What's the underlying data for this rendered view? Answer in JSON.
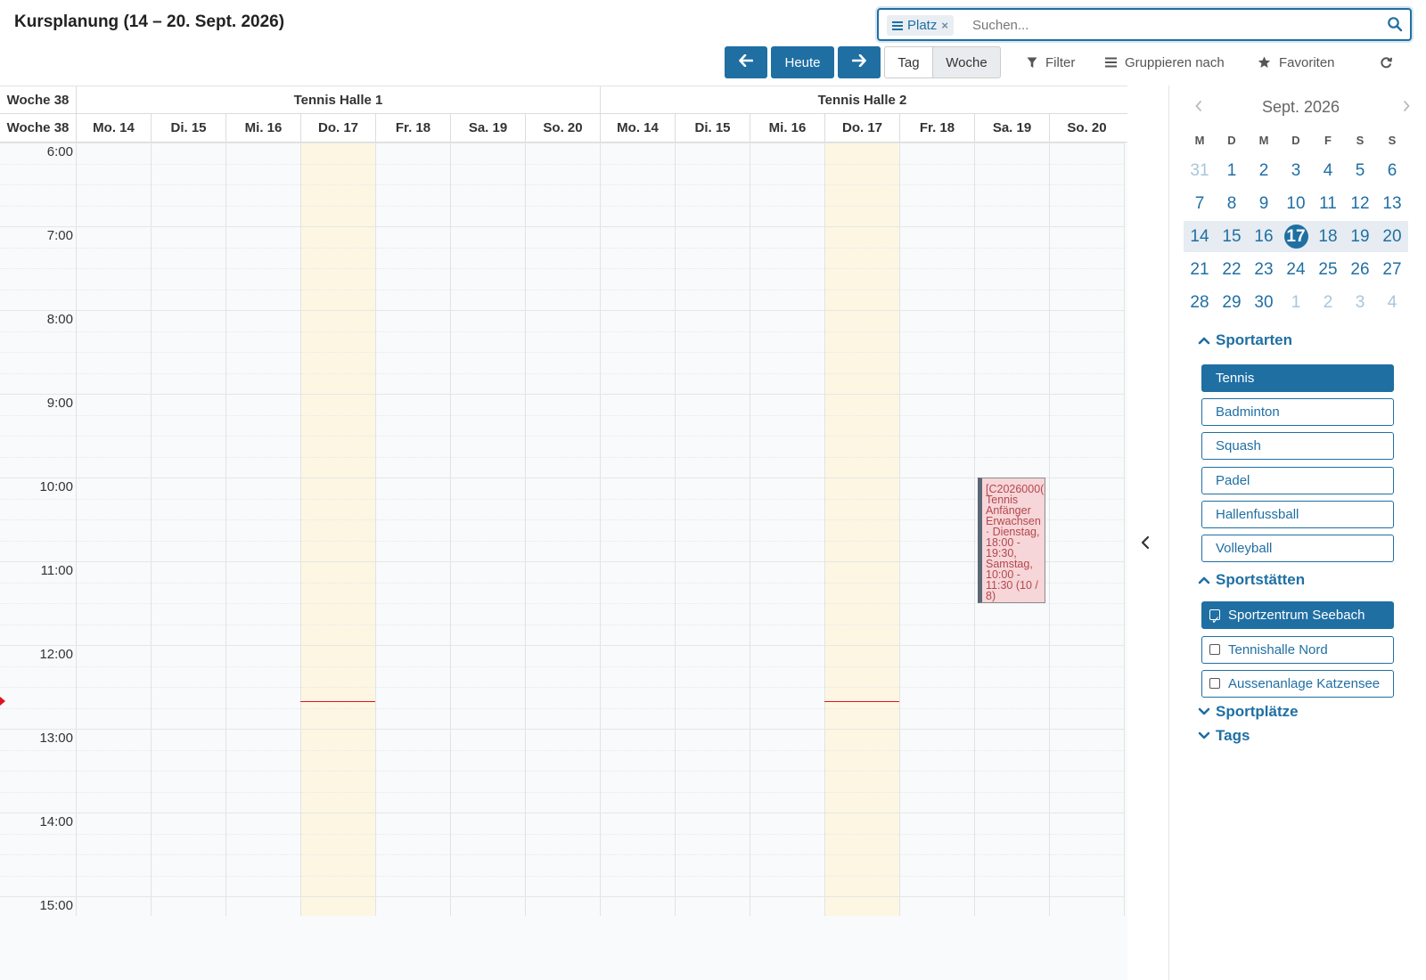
{
  "header": {
    "title": "Kursplanung (14 – 20. Sept. 2026)",
    "facet_label": "Platz",
    "facet_remove": "×",
    "search_placeholder": "Suchen..."
  },
  "toolbar": {
    "prev_label": "←",
    "today_label": "Heute",
    "next_label": "→",
    "day_label": "Tag",
    "week_label": "Woche",
    "filter_label": "Filter",
    "group_label": "Gruppieren nach",
    "favorites_label": "Favoriten"
  },
  "calendar": {
    "week_label": "Woche 38",
    "resources": [
      "Tennis Halle 1",
      "Tennis Halle 2"
    ],
    "days": [
      "Mo. 14",
      "Di. 15",
      "Mi. 16",
      "Do. 17",
      "Fr. 18",
      "Sa. 19",
      "So. 20"
    ],
    "today_day": "Do. 17",
    "hours": [
      "6:00",
      "7:00",
      "8:00",
      "9:00",
      "10:00",
      "11:00",
      "12:00",
      "13:00",
      "14:00",
      "15:00"
    ],
    "now_time": "12:40",
    "events": [
      {
        "resource": "Tennis Halle 2",
        "day": "Sa. 19",
        "start": "10:00",
        "end": "11:30",
        "text": "[C2026000(\nTennis\nAnfänger\nErwachsen\n· Dienstag,\n18:00 -\n19:30,\nSamstag,\n10:00 -\n11:30 (10 /\n8)",
        "color": "#f6d6d8",
        "text_color": "#b5474f"
      }
    ]
  },
  "sidebar": {
    "mini_calendar": {
      "month": "Sept. 2026",
      "dow": [
        "M",
        "D",
        "M",
        "D",
        "F",
        "S",
        "S"
      ],
      "weeks": [
        [
          "31",
          "1",
          "2",
          "3",
          "4",
          "5",
          "6"
        ],
        [
          "7",
          "8",
          "9",
          "10",
          "11",
          "12",
          "13"
        ],
        [
          "14",
          "15",
          "16",
          "17",
          "18",
          "19",
          "20"
        ],
        [
          "21",
          "22",
          "23",
          "24",
          "25",
          "26",
          "27"
        ],
        [
          "28",
          "29",
          "30",
          "1",
          "2",
          "3",
          "4"
        ]
      ],
      "selected_week_index": 2,
      "today": "17"
    },
    "sportarten": {
      "title": "Sportarten",
      "expanded": true,
      "items": [
        {
          "label": "Tennis",
          "active": true
        },
        {
          "label": "Badminton",
          "active": false
        },
        {
          "label": "Squash",
          "active": false
        },
        {
          "label": "Padel",
          "active": false
        },
        {
          "label": "Hallenfussball",
          "active": false
        },
        {
          "label": "Volleyball",
          "active": false
        }
      ]
    },
    "sportstaetten": {
      "title": "Sportstätten",
      "expanded": true,
      "items": [
        {
          "label": "Sportzentrum Seebach",
          "checked": true
        },
        {
          "label": "Tennishalle Nord",
          "checked": false
        },
        {
          "label": "Aussenanlage Katzensee",
          "checked": false
        }
      ]
    },
    "sportplaetze": {
      "title": "Sportplätze",
      "expanded": false
    },
    "tags": {
      "title": "Tags",
      "expanded": false
    }
  },
  "colors": {
    "primary": "#1f6fa3",
    "today_column": "#fcf6e3",
    "now_line": "#e0141e"
  }
}
